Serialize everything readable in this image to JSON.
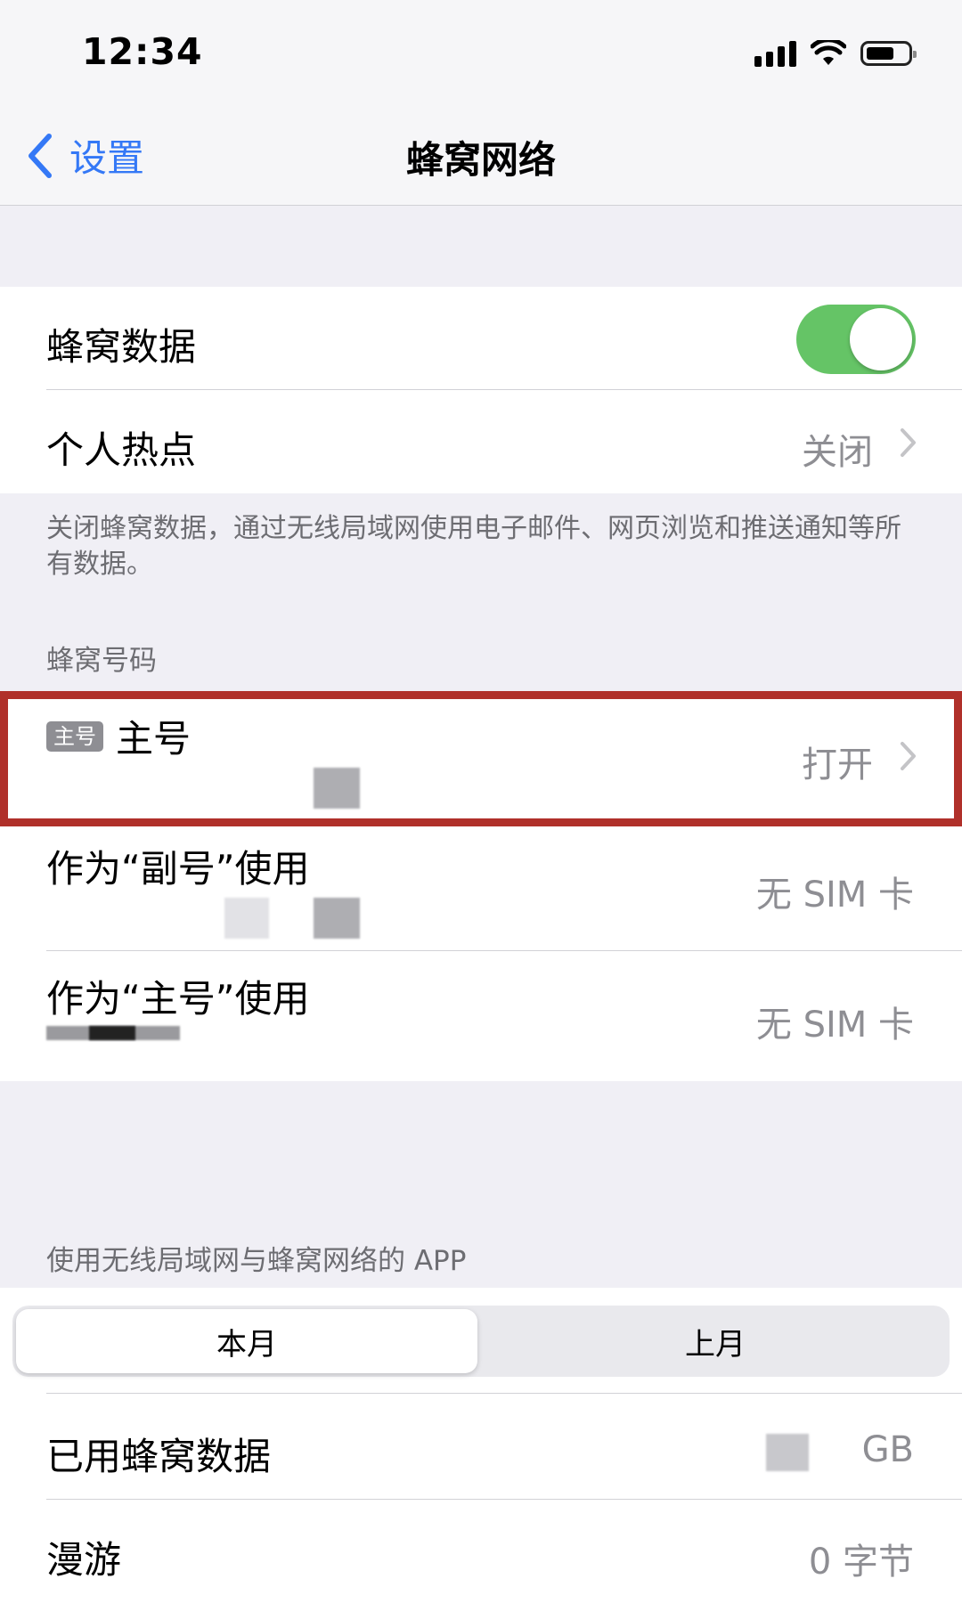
{
  "status_bar": {
    "time": "12:34",
    "signal_bars": 4,
    "battery_level": 0.6
  },
  "nav": {
    "back_label": "设置",
    "title": "蜂窝网络"
  },
  "main_group": {
    "cellular_data": {
      "label": "蜂窝数据",
      "enabled": true
    },
    "hotspot": {
      "label": "个人热点",
      "value": "关闭"
    }
  },
  "footer_note": "关闭蜂窝数据，通过无线局域网使用电子邮件、网页浏览和推送通知等所有数据。",
  "numbers_section": {
    "header": "蜂窝号码",
    "rows": [
      {
        "badge": "主号",
        "label": "主号",
        "value": "打开"
      },
      {
        "label": "作为“副号”使用",
        "value": "无 SIM 卡"
      },
      {
        "label": "作为“主号”使用",
        "value": "无 SIM 卡"
      }
    ]
  },
  "apps_section": {
    "header": "使用无线局域网与蜂窝网络的 APP",
    "segments": [
      "本月",
      "上月"
    ],
    "selected_segment": 0
  },
  "usage": {
    "used": {
      "label": "已用蜂窝数据",
      "unit": "GB"
    },
    "roaming": {
      "label": "漫游",
      "value": "0 字节"
    }
  },
  "colors": {
    "accent": "#3478f6",
    "toggle_on": "#65c466",
    "highlight": "#b0302a"
  }
}
